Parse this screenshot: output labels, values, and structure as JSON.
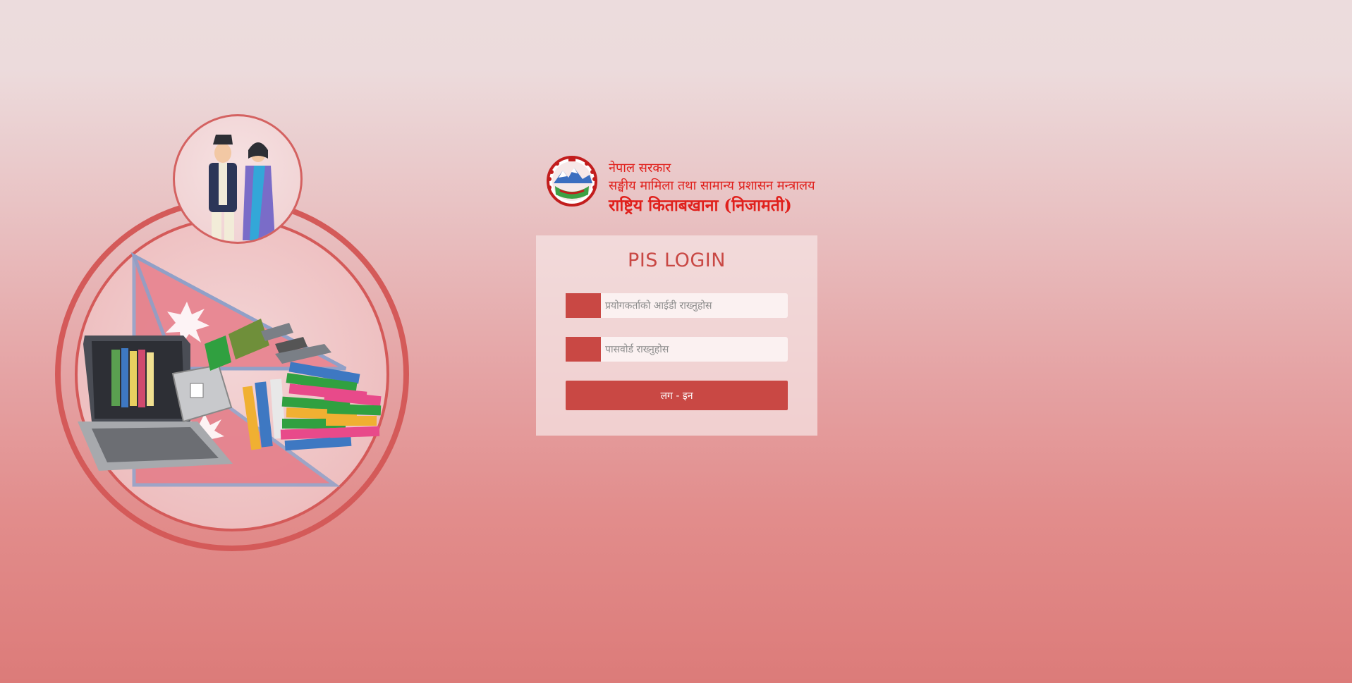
{
  "brand": {
    "line1": "नेपाल सरकार",
    "line2": "सङ्घीय मामिला तथा सामान्य प्रशासन मन्त्रालय",
    "line3": "राष्ट्रिय किताबखाना (निजामती)"
  },
  "login": {
    "title": "PIS LOGIN",
    "username_placeholder": "प्रयोगकर्ताको आईडी राख्नुहोस",
    "username_value": "",
    "password_placeholder": "पासवोर्ड राख्नुहोस",
    "password_value": "",
    "button_label": "लग - इन"
  },
  "icons": {
    "user_field": "user-icon",
    "password_field": "lock-icon",
    "emblem": "nepal-emblem"
  },
  "colors": {
    "accent": "#c94844",
    "brand_text": "#e0201c"
  }
}
